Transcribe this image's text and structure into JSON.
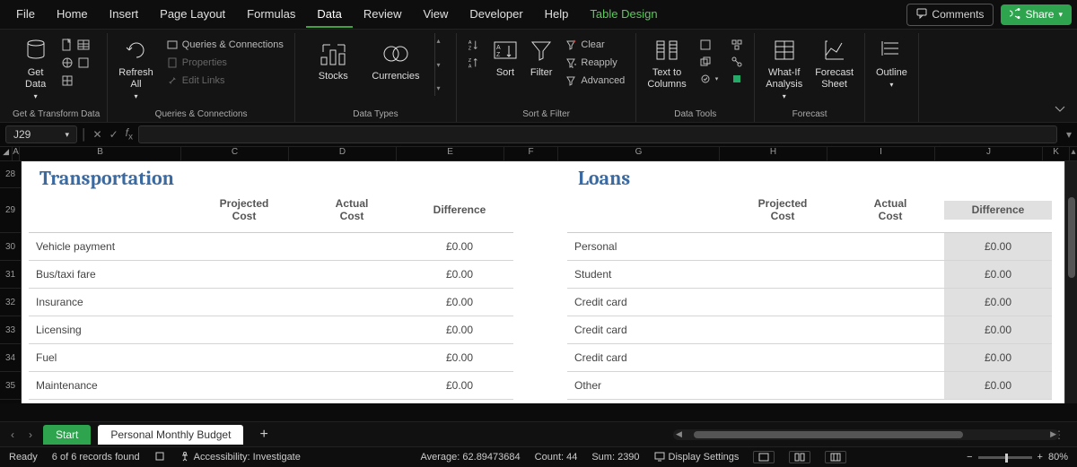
{
  "menu": {
    "items": [
      "File",
      "Home",
      "Insert",
      "Page Layout",
      "Formulas",
      "Data",
      "Review",
      "View",
      "Developer",
      "Help",
      "Table Design"
    ],
    "active_index": 5,
    "comments": "Comments",
    "share": "Share"
  },
  "ribbon": {
    "groups": {
      "getdata": {
        "label": "Get & Transform Data",
        "get_data": "Get\nData"
      },
      "queries": {
        "label": "Queries & Connections",
        "refresh": "Refresh\nAll",
        "qc": "Queries & Connections",
        "props": "Properties",
        "edit_links": "Edit Links"
      },
      "datatypes": {
        "label": "Data Types",
        "stocks": "Stocks",
        "currencies": "Currencies"
      },
      "sortfilter": {
        "label": "Sort & Filter",
        "sort": "Sort",
        "filter": "Filter",
        "clear": "Clear",
        "reapply": "Reapply",
        "advanced": "Advanced"
      },
      "datatools": {
        "label": "Data Tools",
        "ttc": "Text to\nColumns"
      },
      "forecast": {
        "label": "Forecast",
        "whatif": "What-If\nAnalysis",
        "fsheet": "Forecast\nSheet"
      },
      "outline": {
        "label": "",
        "outline": "Outline"
      }
    }
  },
  "formula": {
    "namebox": "J29"
  },
  "columns": [
    "A",
    "B",
    "C",
    "D",
    "E",
    "F",
    "G",
    "H",
    "I",
    "J",
    "K"
  ],
  "rows": [
    28,
    29,
    30,
    31,
    32,
    33,
    34,
    35
  ],
  "row_heights": {
    "title": 30,
    "header": 50,
    "data": 31
  },
  "sections": {
    "left": {
      "title": "Transportation",
      "headers": [
        "Projected\nCost",
        "Actual\nCost",
        "Difference"
      ],
      "items": [
        {
          "name": "Vehicle payment",
          "diff": "£0.00"
        },
        {
          "name": "Bus/taxi fare",
          "diff": "£0.00"
        },
        {
          "name": "Insurance",
          "diff": "£0.00"
        },
        {
          "name": "Licensing",
          "diff": "£0.00"
        },
        {
          "name": "Fuel",
          "diff": "£0.00"
        },
        {
          "name": "Maintenance",
          "diff": "£0.00"
        }
      ]
    },
    "right": {
      "title": "Loans",
      "headers": [
        "Projected\nCost",
        "Actual\nCost",
        "Difference"
      ],
      "items": [
        {
          "name": "Personal",
          "diff": "£0.00"
        },
        {
          "name": "Student",
          "diff": "£0.00"
        },
        {
          "name": "Credit card",
          "diff": "£0.00"
        },
        {
          "name": "Credit card",
          "diff": "£0.00"
        },
        {
          "name": "Credit card",
          "diff": "£0.00"
        },
        {
          "name": "Other",
          "diff": "£0.00"
        }
      ]
    }
  },
  "tabs": {
    "start": "Start",
    "active": "Personal Monthly Budget"
  },
  "status": {
    "ready": "Ready",
    "records": "6 of 6 records found",
    "access": "Accessibility: Investigate",
    "avg": "Average: 62.89473684",
    "count": "Count: 44",
    "sum": "Sum: 2390",
    "display": "Display Settings",
    "zoom": "80%"
  },
  "colwidths": {
    "A": 8,
    "B": 180,
    "C": 120,
    "D": 120,
    "E": 120,
    "spacer": 60,
    "G": 180,
    "H": 120,
    "I": 120,
    "J": 120
  }
}
